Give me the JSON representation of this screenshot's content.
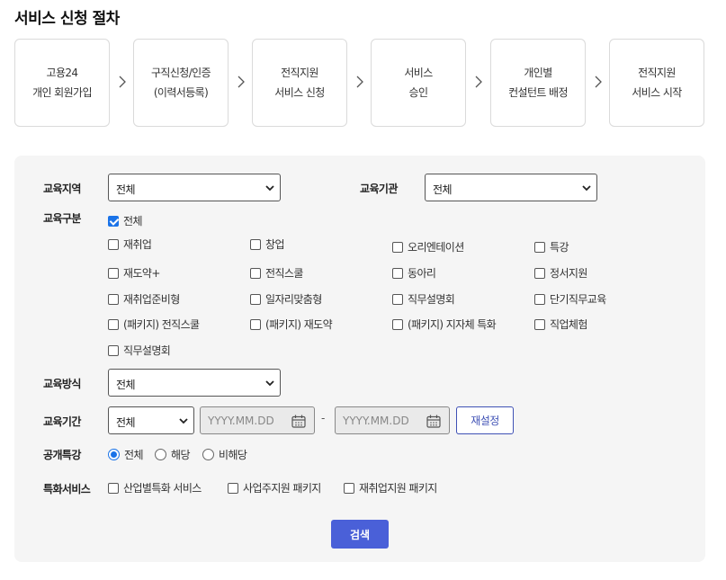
{
  "page_title": "서비스 신청 절차",
  "steps": [
    {
      "line1": "고용24",
      "line2": "개인 회원가입"
    },
    {
      "line1": "구직신청/인증",
      "line2": "(이력서등록)"
    },
    {
      "line1": "전직지원",
      "line2": "서비스 신청"
    },
    {
      "line1": "서비스",
      "line2": "승인"
    },
    {
      "line1": "개인별",
      "line2": "컨설턴트 배정"
    },
    {
      "line1": "전직지원",
      "line2": "서비스 시작"
    }
  ],
  "form": {
    "region": {
      "label": "교육지역",
      "value": "전체"
    },
    "institution": {
      "label": "교육기관",
      "value": "전체"
    },
    "category": {
      "label": "교육구분",
      "all": {
        "label": "전체",
        "checked": true
      },
      "options": [
        "재취업",
        "창업",
        "오리엔테이션",
        "특강",
        "재도약+",
        "전직스쿨",
        "동아리",
        "정서지원",
        "재취업준비형",
        "일자리맞춤형",
        "직무설명회",
        "단기직무교육",
        "(패키지) 전직스쿨",
        "(패키지) 재도약",
        "(패키지) 지자체 특화",
        "직업체험",
        "직무설명회"
      ]
    },
    "method": {
      "label": "교육방식",
      "value": "전체"
    },
    "period": {
      "label": "교육기간",
      "select_value": "전체",
      "start_placeholder": "YYYY.MM.DD",
      "separator": "-",
      "end_placeholder": "YYYY.MM.DD",
      "reset_label": "재설정"
    },
    "public_lecture": {
      "label": "공개특강",
      "options": [
        "전체",
        "해당",
        "비해당"
      ],
      "selected": "전체"
    },
    "special_service": {
      "label": "특화서비스",
      "options": [
        "산업별특화 서비스",
        "사업주지원 패키지",
        "재취업지원 패키지"
      ]
    },
    "search_label": "검색"
  },
  "colors": {
    "accent": "#1a73e8",
    "search_button": "#4a60d8",
    "reset_border": "#3f51b5",
    "panel_bg": "#f5f5f5"
  }
}
